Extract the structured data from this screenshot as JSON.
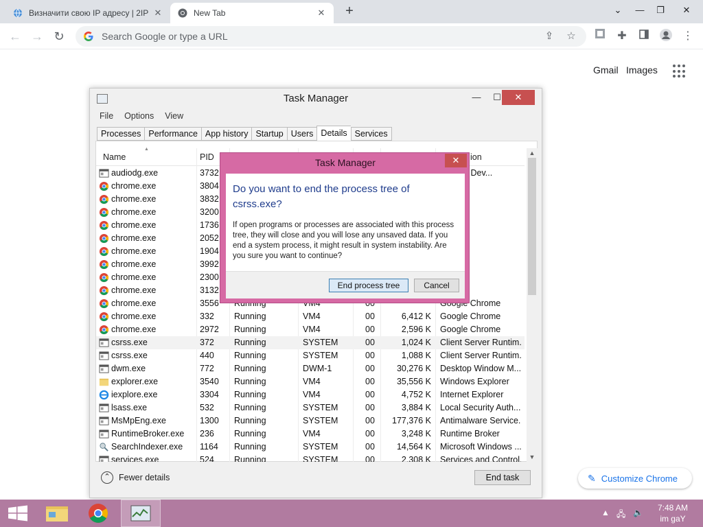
{
  "browser": {
    "tabs": [
      {
        "title": "Визначити свою IP адресу | 2IP",
        "icon": "globe-icon",
        "active": false
      },
      {
        "title": "New Tab",
        "icon": "chrome-icon",
        "active": true
      }
    ],
    "omnibox_placeholder": "Search Google or type a URL",
    "ntp_links": {
      "gmail": "Gmail",
      "images": "Images"
    },
    "customize_label": "Customize Chrome"
  },
  "task_manager": {
    "title": "Task Manager",
    "menu": [
      "File",
      "Options",
      "View"
    ],
    "tabs": [
      "Processes",
      "Performance",
      "App history",
      "Startup",
      "Users",
      "Details",
      "Services"
    ],
    "selected_tab": "Details",
    "columns": {
      "name": "Name",
      "pid": "PID",
      "description_partial": "ion"
    },
    "rows": [
      {
        "name": "audiodg.exe",
        "pid": "3732",
        "status": "",
        "user": "",
        "cpu": "",
        "mem": "",
        "desc": "s Audio Dev...",
        "icon": "generic"
      },
      {
        "name": "chrome.exe",
        "pid": "3804",
        "status": "",
        "user": "",
        "cpu": "",
        "mem": "",
        "desc": "hrome",
        "icon": "chrome"
      },
      {
        "name": "chrome.exe",
        "pid": "3832",
        "status": "",
        "user": "",
        "cpu": "",
        "mem": "",
        "desc": "hrome",
        "icon": "chrome"
      },
      {
        "name": "chrome.exe",
        "pid": "3200",
        "status": "",
        "user": "",
        "cpu": "",
        "mem": "",
        "desc": "hrome",
        "icon": "chrome"
      },
      {
        "name": "chrome.exe",
        "pid": "1736",
        "status": "",
        "user": "",
        "cpu": "",
        "mem": "",
        "desc": "hrome",
        "icon": "chrome"
      },
      {
        "name": "chrome.exe",
        "pid": "2052",
        "status": "",
        "user": "",
        "cpu": "",
        "mem": "",
        "desc": "hrome",
        "icon": "chrome"
      },
      {
        "name": "chrome.exe",
        "pid": "1904",
        "status": "",
        "user": "",
        "cpu": "",
        "mem": "",
        "desc": "hrome",
        "icon": "chrome"
      },
      {
        "name": "chrome.exe",
        "pid": "3992",
        "status": "",
        "user": "",
        "cpu": "",
        "mem": "",
        "desc": "hrome",
        "icon": "chrome"
      },
      {
        "name": "chrome.exe",
        "pid": "2300",
        "status": "",
        "user": "",
        "cpu": "",
        "mem": "",
        "desc": "hrome",
        "icon": "chrome"
      },
      {
        "name": "chrome.exe",
        "pid": "3132",
        "status": "",
        "user": "",
        "cpu": "",
        "mem": "",
        "desc": "hrome",
        "icon": "chrome"
      },
      {
        "name": "chrome.exe",
        "pid": "3556",
        "status": "Running",
        "user": "VM4",
        "cpu": "00",
        "mem": "",
        "desc": "Google Chrome",
        "icon": "chrome"
      },
      {
        "name": "chrome.exe",
        "pid": "332",
        "status": "Running",
        "user": "VM4",
        "cpu": "00",
        "mem": "6,412 K",
        "desc": "Google Chrome",
        "icon": "chrome"
      },
      {
        "name": "chrome.exe",
        "pid": "2972",
        "status": "Running",
        "user": "VM4",
        "cpu": "00",
        "mem": "2,596 K",
        "desc": "Google Chrome",
        "icon": "chrome"
      },
      {
        "name": "csrss.exe",
        "pid": "372",
        "status": "Running",
        "user": "SYSTEM",
        "cpu": "00",
        "mem": "1,024 K",
        "desc": "Client Server Runtim...",
        "icon": "generic"
      },
      {
        "name": "csrss.exe",
        "pid": "440",
        "status": "Running",
        "user": "SYSTEM",
        "cpu": "00",
        "mem": "1,088 K",
        "desc": "Client Server Runtim...",
        "icon": "generic"
      },
      {
        "name": "dwm.exe",
        "pid": "772",
        "status": "Running",
        "user": "DWM-1",
        "cpu": "00",
        "mem": "30,276 K",
        "desc": "Desktop Window M...",
        "icon": "generic"
      },
      {
        "name": "explorer.exe",
        "pid": "3540",
        "status": "Running",
        "user": "VM4",
        "cpu": "00",
        "mem": "35,556 K",
        "desc": "Windows Explorer",
        "icon": "folder"
      },
      {
        "name": "iexplore.exe",
        "pid": "3304",
        "status": "Running",
        "user": "VM4",
        "cpu": "00",
        "mem": "4,752 K",
        "desc": "Internet Explorer",
        "icon": "ie"
      },
      {
        "name": "lsass.exe",
        "pid": "532",
        "status": "Running",
        "user": "SYSTEM",
        "cpu": "00",
        "mem": "3,884 K",
        "desc": "Local Security Auth...",
        "icon": "generic"
      },
      {
        "name": "MsMpEng.exe",
        "pid": "1300",
        "status": "Running",
        "user": "SYSTEM",
        "cpu": "00",
        "mem": "177,376 K",
        "desc": "Antimalware Service...",
        "icon": "generic"
      },
      {
        "name": "RuntimeBroker.exe",
        "pid": "236",
        "status": "Running",
        "user": "VM4",
        "cpu": "00",
        "mem": "3,248 K",
        "desc": "Runtime Broker",
        "icon": "generic"
      },
      {
        "name": "SearchIndexer.exe",
        "pid": "1164",
        "status": "Running",
        "user": "SYSTEM",
        "cpu": "00",
        "mem": "14,564 K",
        "desc": "Microsoft Windows ...",
        "icon": "search"
      },
      {
        "name": "services.exe",
        "pid": "524",
        "status": "Running",
        "user": "SYSTEM",
        "cpu": "00",
        "mem": "2,308 K",
        "desc": "Services and Control...",
        "icon": "generic"
      }
    ],
    "selected_row_index": 13,
    "fewer_details": "Fewer details",
    "end_task": "End task"
  },
  "dialog": {
    "title": "Task Manager",
    "question": "Do you want to end the process tree of csrss.exe?",
    "message": "If open programs or processes are associated with this process tree, they will close and you will lose any unsaved data. If you end a system process, it might result in system instability. Are you sure you want to continue?",
    "confirm_label": "End process tree",
    "cancel_label": "Cancel"
  },
  "taskbar": {
    "time": "7:48 AM",
    "date": "im gaY"
  },
  "colors": {
    "taskbar": "#b17ba0",
    "dialog_frame": "#d66aa4",
    "close_red": "#c75050",
    "question_blue": "#1f3c8c"
  }
}
